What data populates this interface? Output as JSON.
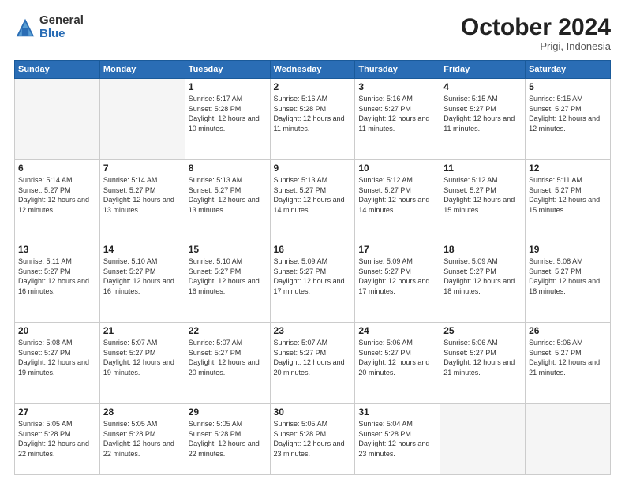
{
  "logo": {
    "general": "General",
    "blue": "Blue"
  },
  "header": {
    "month": "October 2024",
    "location": "Prigi, Indonesia"
  },
  "weekdays": [
    "Sunday",
    "Monday",
    "Tuesday",
    "Wednesday",
    "Thursday",
    "Friday",
    "Saturday"
  ],
  "weeks": [
    [
      {
        "day": "",
        "info": ""
      },
      {
        "day": "",
        "info": ""
      },
      {
        "day": "1",
        "info": "Sunrise: 5:17 AM\nSunset: 5:28 PM\nDaylight: 12 hours and 10 minutes."
      },
      {
        "day": "2",
        "info": "Sunrise: 5:16 AM\nSunset: 5:28 PM\nDaylight: 12 hours and 11 minutes."
      },
      {
        "day": "3",
        "info": "Sunrise: 5:16 AM\nSunset: 5:27 PM\nDaylight: 12 hours and 11 minutes."
      },
      {
        "day": "4",
        "info": "Sunrise: 5:15 AM\nSunset: 5:27 PM\nDaylight: 12 hours and 11 minutes."
      },
      {
        "day": "5",
        "info": "Sunrise: 5:15 AM\nSunset: 5:27 PM\nDaylight: 12 hours and 12 minutes."
      }
    ],
    [
      {
        "day": "6",
        "info": "Sunrise: 5:14 AM\nSunset: 5:27 PM\nDaylight: 12 hours and 12 minutes."
      },
      {
        "day": "7",
        "info": "Sunrise: 5:14 AM\nSunset: 5:27 PM\nDaylight: 12 hours and 13 minutes."
      },
      {
        "day": "8",
        "info": "Sunrise: 5:13 AM\nSunset: 5:27 PM\nDaylight: 12 hours and 13 minutes."
      },
      {
        "day": "9",
        "info": "Sunrise: 5:13 AM\nSunset: 5:27 PM\nDaylight: 12 hours and 14 minutes."
      },
      {
        "day": "10",
        "info": "Sunrise: 5:12 AM\nSunset: 5:27 PM\nDaylight: 12 hours and 14 minutes."
      },
      {
        "day": "11",
        "info": "Sunrise: 5:12 AM\nSunset: 5:27 PM\nDaylight: 12 hours and 15 minutes."
      },
      {
        "day": "12",
        "info": "Sunrise: 5:11 AM\nSunset: 5:27 PM\nDaylight: 12 hours and 15 minutes."
      }
    ],
    [
      {
        "day": "13",
        "info": "Sunrise: 5:11 AM\nSunset: 5:27 PM\nDaylight: 12 hours and 16 minutes."
      },
      {
        "day": "14",
        "info": "Sunrise: 5:10 AM\nSunset: 5:27 PM\nDaylight: 12 hours and 16 minutes."
      },
      {
        "day": "15",
        "info": "Sunrise: 5:10 AM\nSunset: 5:27 PM\nDaylight: 12 hours and 16 minutes."
      },
      {
        "day": "16",
        "info": "Sunrise: 5:09 AM\nSunset: 5:27 PM\nDaylight: 12 hours and 17 minutes."
      },
      {
        "day": "17",
        "info": "Sunrise: 5:09 AM\nSunset: 5:27 PM\nDaylight: 12 hours and 17 minutes."
      },
      {
        "day": "18",
        "info": "Sunrise: 5:09 AM\nSunset: 5:27 PM\nDaylight: 12 hours and 18 minutes."
      },
      {
        "day": "19",
        "info": "Sunrise: 5:08 AM\nSunset: 5:27 PM\nDaylight: 12 hours and 18 minutes."
      }
    ],
    [
      {
        "day": "20",
        "info": "Sunrise: 5:08 AM\nSunset: 5:27 PM\nDaylight: 12 hours and 19 minutes."
      },
      {
        "day": "21",
        "info": "Sunrise: 5:07 AM\nSunset: 5:27 PM\nDaylight: 12 hours and 19 minutes."
      },
      {
        "day": "22",
        "info": "Sunrise: 5:07 AM\nSunset: 5:27 PM\nDaylight: 12 hours and 20 minutes."
      },
      {
        "day": "23",
        "info": "Sunrise: 5:07 AM\nSunset: 5:27 PM\nDaylight: 12 hours and 20 minutes."
      },
      {
        "day": "24",
        "info": "Sunrise: 5:06 AM\nSunset: 5:27 PM\nDaylight: 12 hours and 20 minutes."
      },
      {
        "day": "25",
        "info": "Sunrise: 5:06 AM\nSunset: 5:27 PM\nDaylight: 12 hours and 21 minutes."
      },
      {
        "day": "26",
        "info": "Sunrise: 5:06 AM\nSunset: 5:27 PM\nDaylight: 12 hours and 21 minutes."
      }
    ],
    [
      {
        "day": "27",
        "info": "Sunrise: 5:05 AM\nSunset: 5:28 PM\nDaylight: 12 hours and 22 minutes."
      },
      {
        "day": "28",
        "info": "Sunrise: 5:05 AM\nSunset: 5:28 PM\nDaylight: 12 hours and 22 minutes."
      },
      {
        "day": "29",
        "info": "Sunrise: 5:05 AM\nSunset: 5:28 PM\nDaylight: 12 hours and 22 minutes."
      },
      {
        "day": "30",
        "info": "Sunrise: 5:05 AM\nSunset: 5:28 PM\nDaylight: 12 hours and 23 minutes."
      },
      {
        "day": "31",
        "info": "Sunrise: 5:04 AM\nSunset: 5:28 PM\nDaylight: 12 hours and 23 minutes."
      },
      {
        "day": "",
        "info": ""
      },
      {
        "day": "",
        "info": ""
      }
    ]
  ]
}
